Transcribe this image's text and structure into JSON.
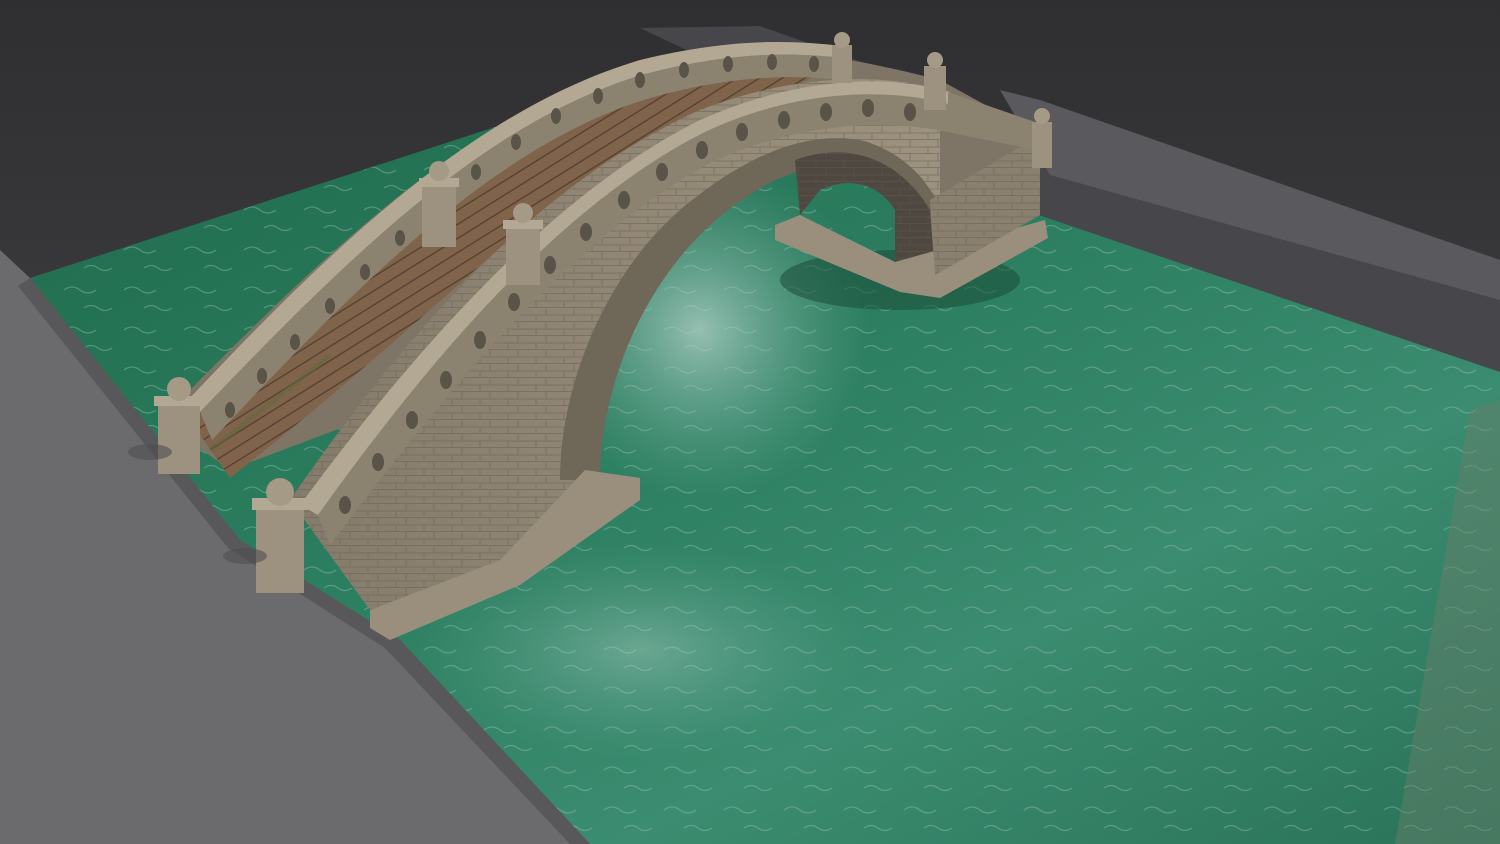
{
  "scene": {
    "subject": "stone-arch-bridge-over-canal",
    "colors": {
      "background_top": "#2f2f31",
      "background_bottom": "#4a4a4c",
      "bank": "#6b6a6c",
      "bank_shadow": "#5a595b",
      "bank_far": "#47464a",
      "water_deep": "#1f6a4c",
      "water_mid": "#2d7f61",
      "water_light": "#6fae9d",
      "stone_light": "#a59a86",
      "stone_mid": "#8a806f",
      "stone_dark": "#5e574b",
      "deck_wood": "#8f6f55",
      "deck_wood_dark": "#6e5442"
    }
  }
}
